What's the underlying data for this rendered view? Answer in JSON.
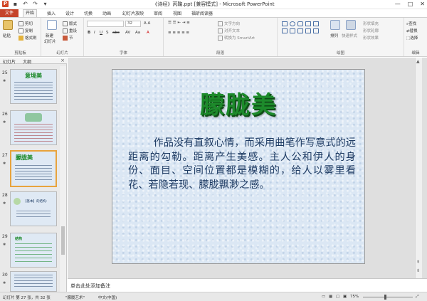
{
  "window": {
    "title": "《诗经》芮鞠.ppt [兼容模式] - Microsoft PowerPoint",
    "controls": [
      "—",
      "□",
      "✕"
    ]
  },
  "tabs": [
    "文件",
    "开始",
    "插入",
    "设计",
    "切换",
    "动画",
    "幻灯片放映",
    "审阅",
    "视图",
    "福昕阅读器"
  ],
  "ribbon": {
    "clipboard": {
      "paste": "粘贴",
      "cut": "剪切",
      "copy": "复制",
      "format_painter": "格式刷",
      "label": "剪贴板"
    },
    "slides": {
      "new_slide": "新建",
      "new_slide_2": "幻灯片",
      "layout": "版式",
      "reset": "重设",
      "section": "节",
      "label": "幻灯片"
    },
    "font": {
      "size": "32",
      "label": "字体"
    },
    "paragraph": {
      "text_direction": "文字方向",
      "align_text": "对齐文本",
      "smartart": "转换为 SmartArt",
      "label": "段落"
    },
    "drawing": {
      "arrange": "排列",
      "quick_styles": "快速样式",
      "shape_fill": "形状填充",
      "shape_outline": "形状轮廓",
      "shape_effects": "形状效果",
      "label": "绘图"
    },
    "editing": {
      "find": "查找",
      "replace": "替换",
      "select": "选择",
      "label": "编辑"
    }
  },
  "left_panel": {
    "tab_slides": "幻灯片",
    "tab_outline": "大纲",
    "close": "×",
    "slides": [
      {
        "num": "25",
        "title": "意境美"
      },
      {
        "num": "26",
        "title": ""
      },
      {
        "num": "27",
        "title": "朦胧美"
      },
      {
        "num": "28",
        "title": "【基本】的结构:"
      },
      {
        "num": "29",
        "title": "结构"
      },
      {
        "num": "30",
        "title": ""
      }
    ]
  },
  "slide": {
    "title": "朦胧美",
    "body": "作品没有直叙心情，而采用曲笔作写意式的远距离的勾勒。距离产生美感。主人公和伊人的身份、面目、空间位置都是模糊的，给人以雾里看花、若隐若现、朦胧飘渺之感。"
  },
  "notes_placeholder": "单击此处添加备注",
  "status": {
    "slide_info": "幻灯片 第 27 张，共 32 张",
    "theme": "\"朦胧艺术\"",
    "language": "中文(中国)",
    "zoom": "75%"
  },
  "colors": {
    "file_tab": "#c5432a",
    "title_green": "#1d8a2b",
    "body_blue": "#1e3b63",
    "selected_thumb": "#e8a33c"
  }
}
